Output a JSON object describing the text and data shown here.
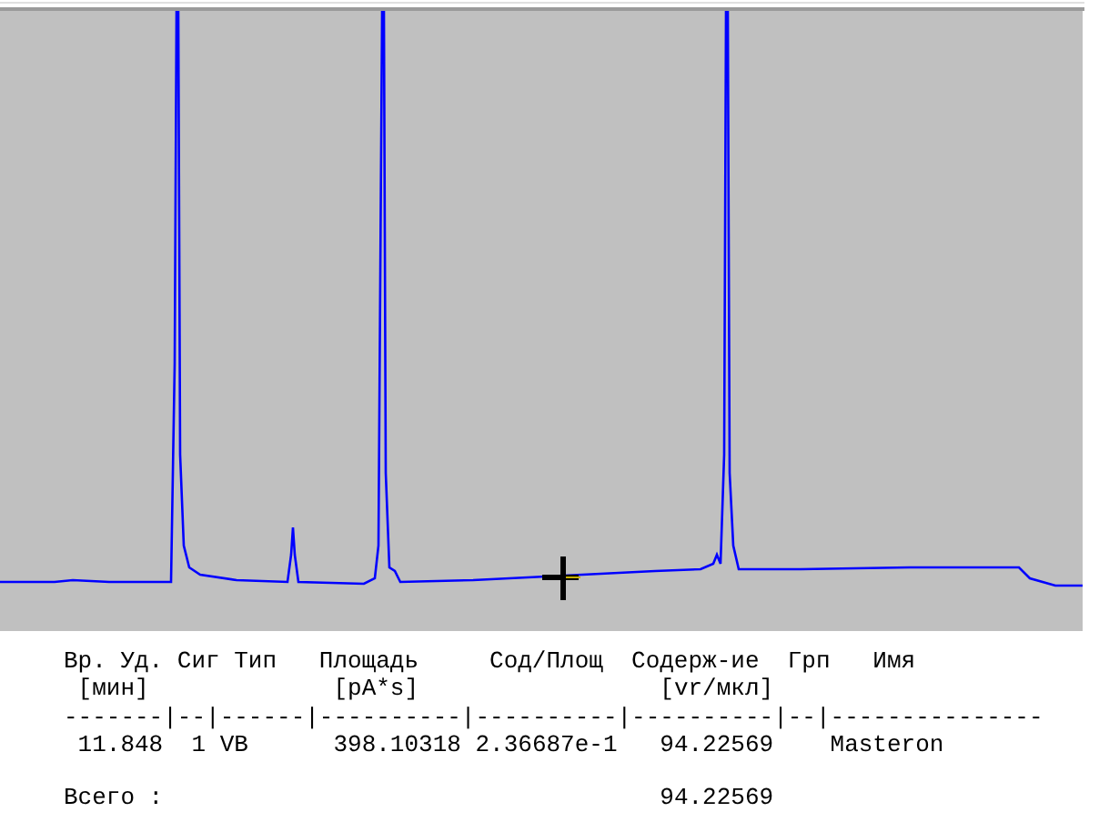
{
  "report": {
    "columns": [
      {
        "header": "Вр. Уд.",
        "unit": "[мин]"
      },
      {
        "header": "Сиг"
      },
      {
        "header": "Тип"
      },
      {
        "header": "Площадь",
        "unit": "[pA*s]"
      },
      {
        "header": "Сод/Площ"
      },
      {
        "header": "Содерж-ие",
        "unit": "[vr/мкл]"
      },
      {
        "header": "Грп"
      },
      {
        "header": "Имя"
      }
    ],
    "separator": "-------|--|------|----------|----------|----------|--|---------------",
    "rows": [
      {
        "ret_time": "11.848",
        "signal": "1",
        "type": "VB",
        "area": "398.10318",
        "amt_area": "2.36687e-1",
        "amount": "94.22569",
        "name": "Masteron"
      }
    ],
    "total": {
      "label": "Всего :",
      "amount": "94.22569"
    }
  }
}
